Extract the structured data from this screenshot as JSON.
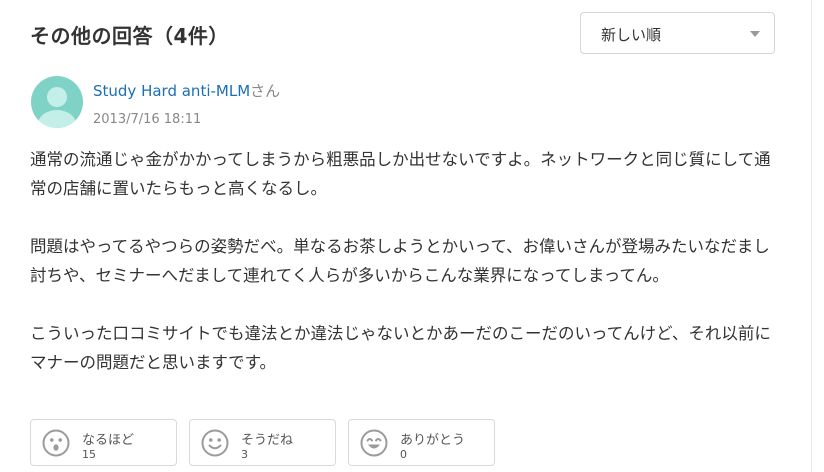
{
  "header": {
    "title": "その他の回答（4件）",
    "sort": {
      "selected": "新しい順",
      "icon": "chevron-down-icon"
    }
  },
  "answer": {
    "avatar_icon": "user-avatar-icon",
    "avatar_colors": {
      "background": "#7fd3c6",
      "figure": "#c4efe8"
    },
    "user_name": "Study Hard anti-MLM",
    "user_suffix": "さん",
    "date": "2013/7/16 18:11",
    "paragraphs": [
      "通常の流通じゃ金がかかってしまうから粗悪品しか出せないですよ。ネットワークと同じ質にして通常の店舗に置いたらもっと高くなるし。",
      "問題はやってるやつらの姿勢だべ。単なるお茶しようとかいって、お偉いさんが登場みたいなだまし討ちや、セミナーへだまして連れてく人らが多いからこんな業界になってしまってん。",
      "こういった口コミサイトでも違法とか違法じゃないとかあーだのこーだのいってんけど、それ以前にマナーの問題だと思いますです。"
    ],
    "reactions": [
      {
        "label": "なるほど",
        "count": "15",
        "icon": "surprised-face-icon"
      },
      {
        "label": "そうだね",
        "count": "3",
        "icon": "smiling-face-icon"
      },
      {
        "label": "ありがとう",
        "count": "0",
        "icon": "grinning-face-icon"
      }
    ]
  },
  "colors": {
    "link": "#1a6fb5",
    "text": "#333333",
    "muted": "#888888",
    "border": "#d9d9d9",
    "icon": "#9b9b9b"
  }
}
